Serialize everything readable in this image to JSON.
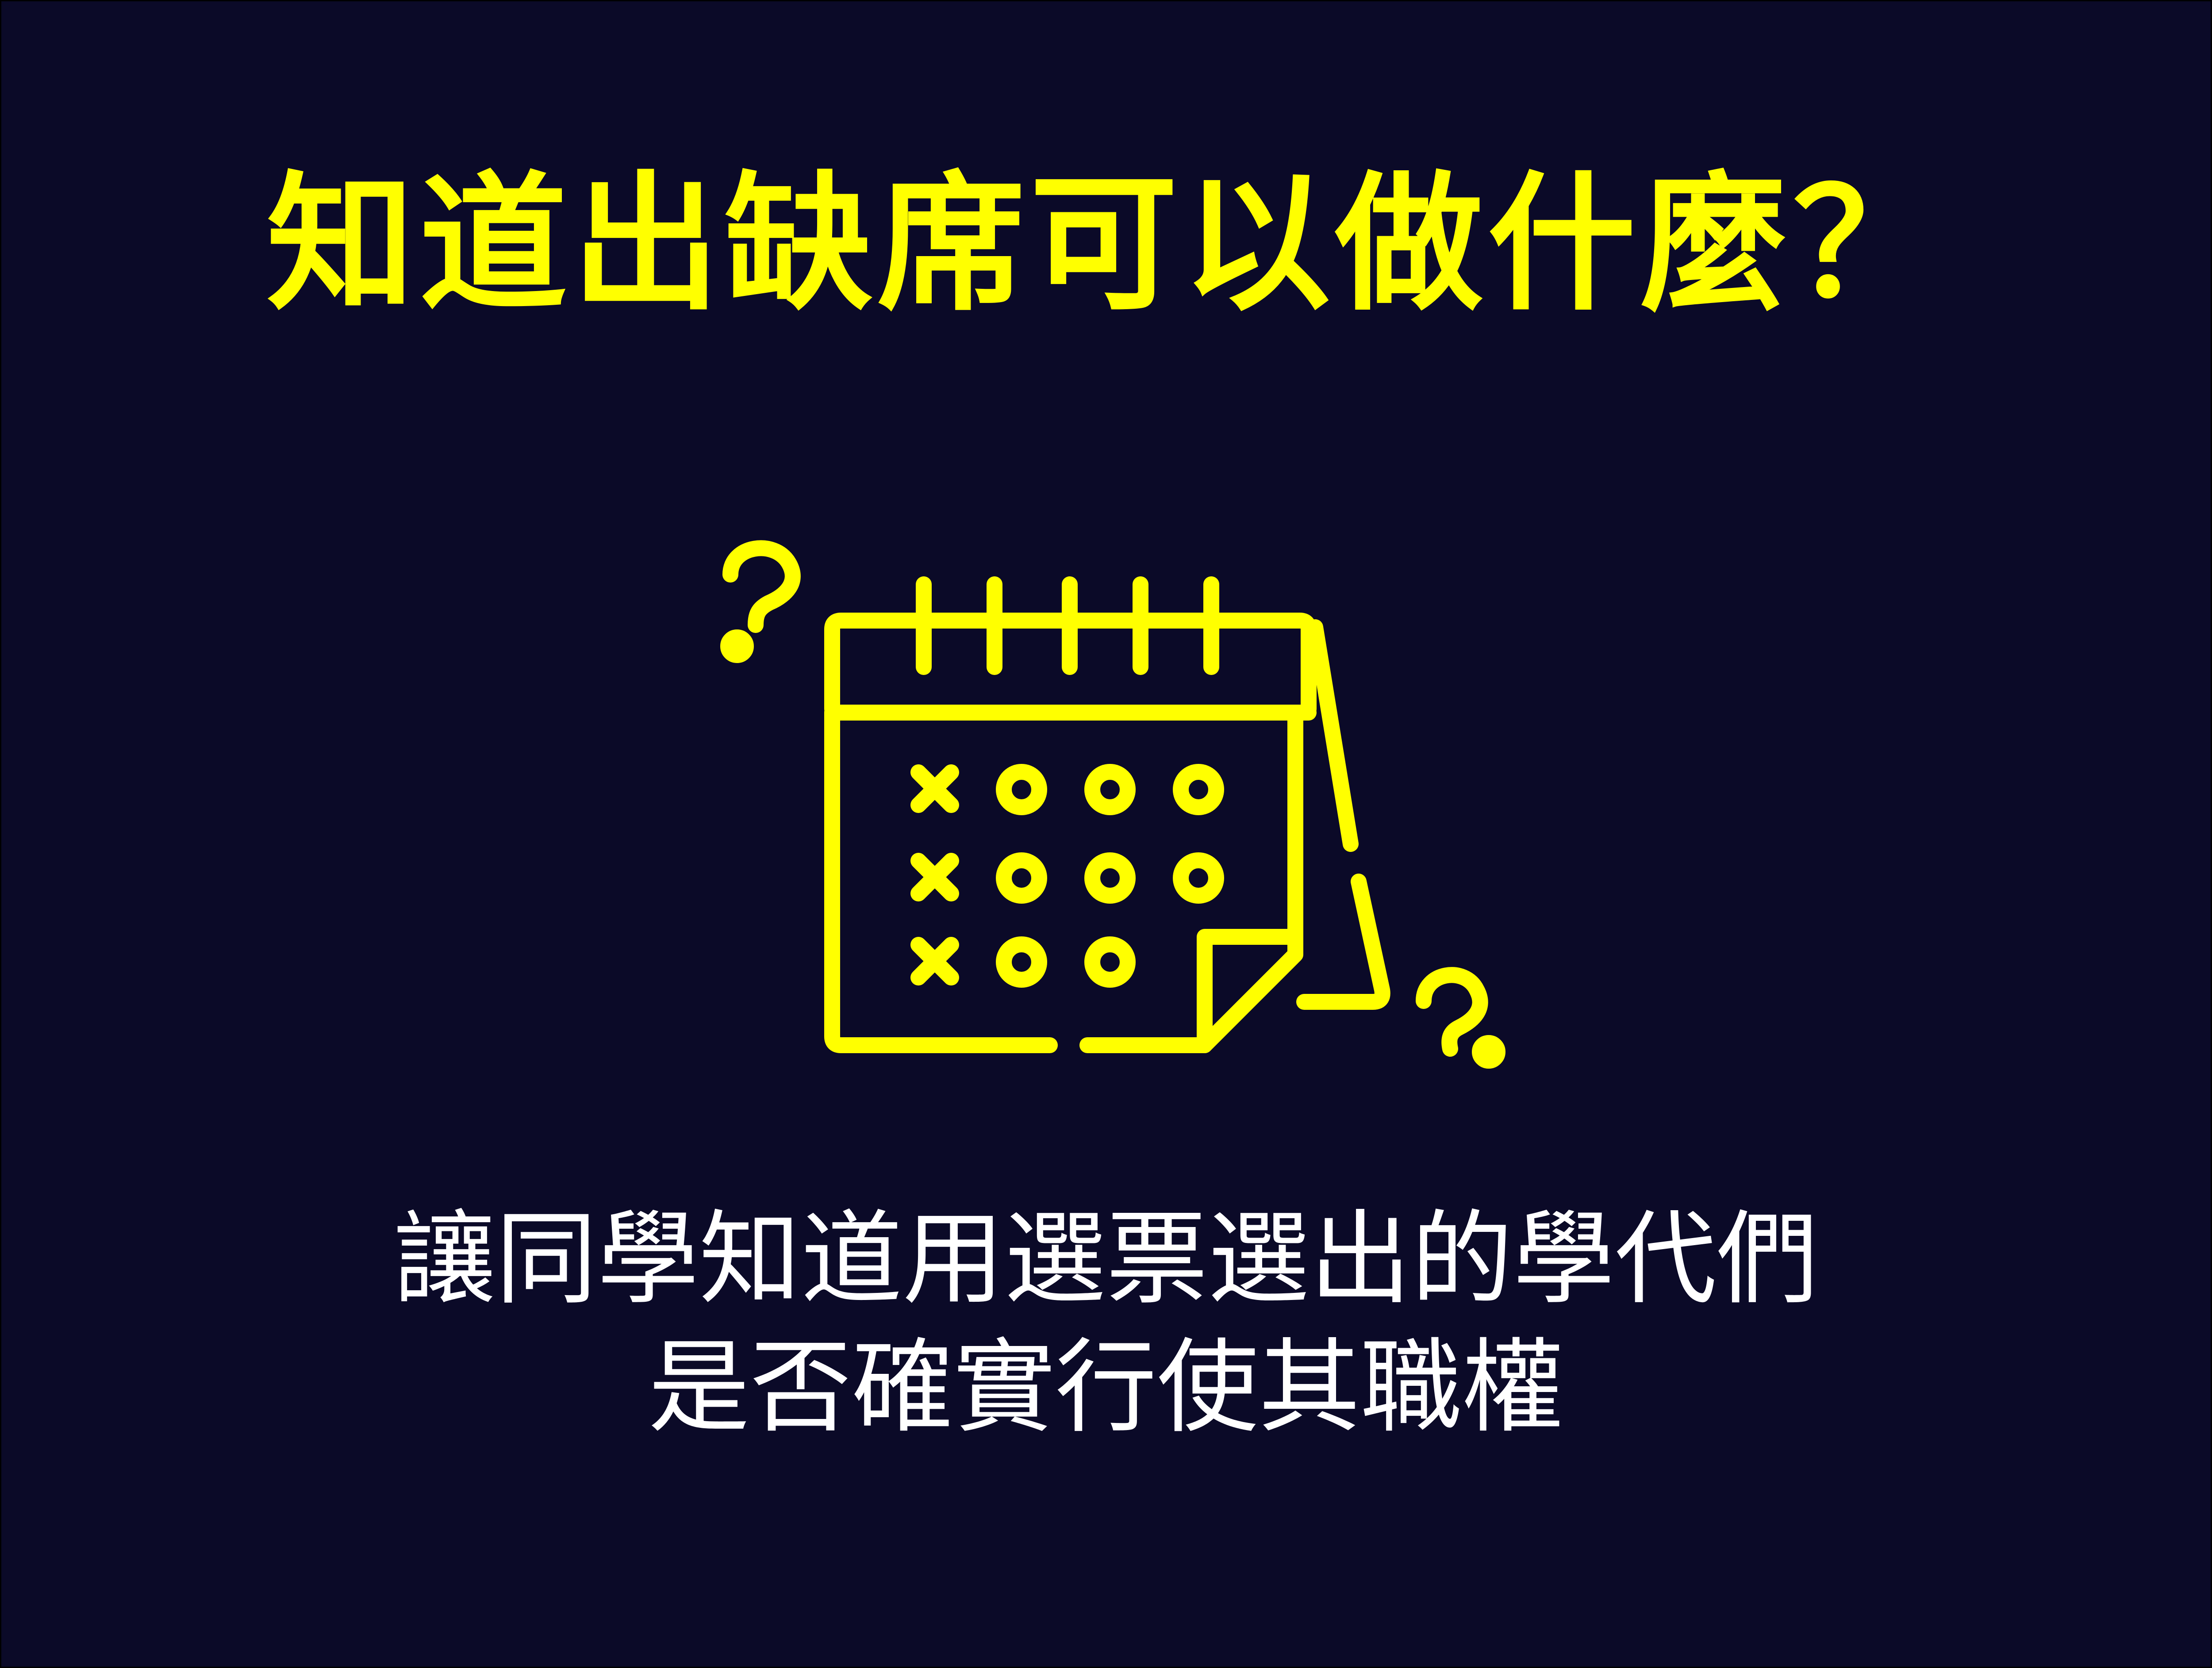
{
  "slide": {
    "title": "知道出缺席可以做什麼？",
    "illustration": {
      "main_icon": "calendar-icon",
      "decorations": [
        "question-mark-icon",
        "question-mark-icon"
      ],
      "attendance_rows": [
        [
          "x",
          "o",
          "o",
          "o"
        ],
        [
          "x",
          "o",
          "o",
          "o"
        ],
        [
          "x",
          "o",
          "o"
        ]
      ]
    },
    "subtitle_lines": [
      "讓同學知道用選票選出的學代們",
      "是否確實行使其職權"
    ]
  },
  "colors": {
    "background": "#0b0a28",
    "accent": "#ffff00",
    "text": "#ffffff"
  }
}
